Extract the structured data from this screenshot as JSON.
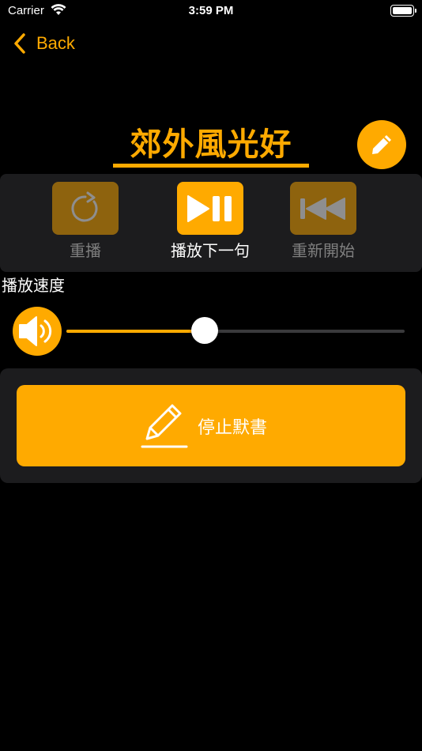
{
  "status_bar": {
    "carrier": "Carrier",
    "time": "3:59 PM"
  },
  "nav": {
    "back_label": "Back"
  },
  "lesson": {
    "title": "郊外風光好"
  },
  "controls": {
    "replay_label": "重播",
    "play_next_label": "播放下一句",
    "restart_label": "重新開始"
  },
  "speed": {
    "label": "播放速度",
    "value": 0.41
  },
  "dictation": {
    "stop_label": "停止默書"
  },
  "colors": {
    "accent": "#FFAA00",
    "panel": "#1c1c1e",
    "background": "#000000"
  }
}
